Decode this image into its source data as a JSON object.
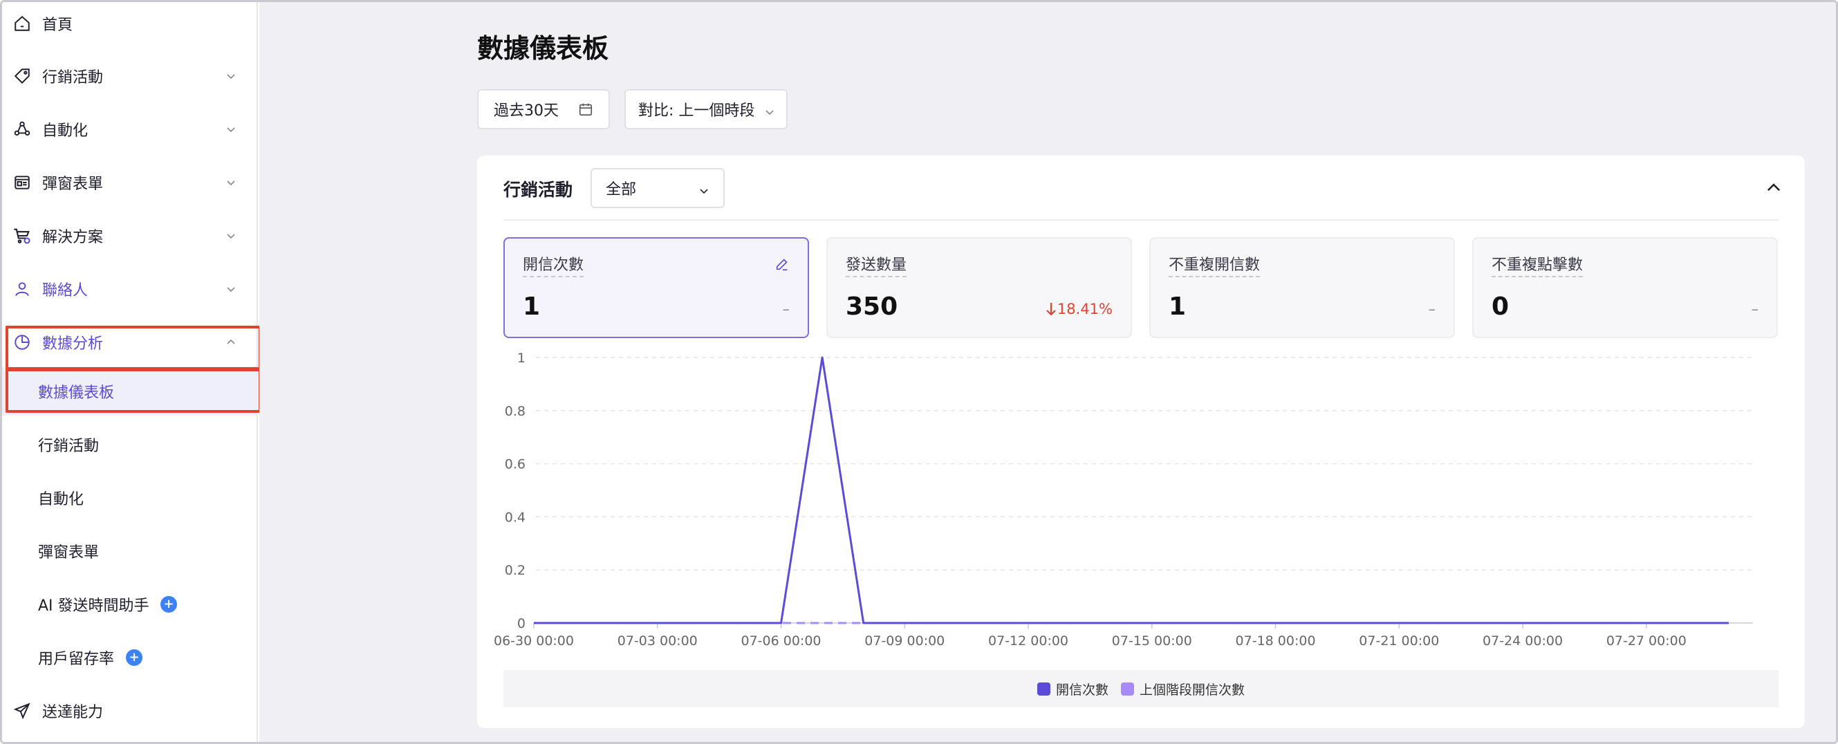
{
  "sidebar": {
    "items": [
      {
        "label": "首頁"
      },
      {
        "label": "行銷活動"
      },
      {
        "label": "自動化"
      },
      {
        "label": "彈窗表單"
      },
      {
        "label": "解決方案"
      },
      {
        "label": "聯絡人"
      },
      {
        "label": "數據分析"
      }
    ],
    "sub_items": [
      {
        "label": "數據儀表板"
      },
      {
        "label": "行銷活動"
      },
      {
        "label": "自動化"
      },
      {
        "label": "彈窗表單"
      },
      {
        "label": "AI 發送時間助手"
      },
      {
        "label": "用戶留存率"
      }
    ],
    "bottom_item": {
      "label": "送達能力"
    }
  },
  "page": {
    "title": "數據儀表板"
  },
  "filters": {
    "date_range": "過去30天",
    "compare": "對比: 上一個時段"
  },
  "card": {
    "title": "行銷活動",
    "select_value": "全部"
  },
  "metrics": [
    {
      "label": "開信次數",
      "value": "1",
      "change": "–"
    },
    {
      "label": "發送數量",
      "value": "350",
      "change": "18.41%"
    },
    {
      "label": "不重複開信數",
      "value": "1",
      "change": "–"
    },
    {
      "label": "不重複點擊數",
      "value": "0",
      "change": "–"
    }
  ],
  "colors": {
    "accent": "#5b4bdb",
    "prev_series": "#a78bfa",
    "down": "#e2432f",
    "annotation": "#e2432f"
  },
  "chart_data": {
    "type": "line",
    "x": [
      "06-30",
      "07-01",
      "07-02",
      "07-03",
      "07-04",
      "07-05",
      "07-06",
      "07-07",
      "07-08",
      "07-09",
      "07-10",
      "07-11",
      "07-12",
      "07-13",
      "07-14",
      "07-15",
      "07-16",
      "07-17",
      "07-18",
      "07-19",
      "07-20",
      "07-21",
      "07-22",
      "07-23",
      "07-24",
      "07-25",
      "07-26",
      "07-27",
      "07-28",
      "07-29"
    ],
    "xticks": [
      "06-30 00:00",
      "07-03 00:00",
      "07-06 00:00",
      "07-09 00:00",
      "07-12 00:00",
      "07-15 00:00",
      "07-18 00:00",
      "07-21 00:00",
      "07-24 00:00",
      "07-27 00:00"
    ],
    "yticks": [
      "0",
      "0.2",
      "0.4",
      "0.6",
      "0.8",
      "1"
    ],
    "ylim": [
      0,
      1
    ],
    "series": [
      {
        "name": "開信次數",
        "values": [
          0,
          0,
          0,
          0,
          0,
          0,
          0,
          1,
          0,
          0,
          0,
          0,
          0,
          0,
          0,
          0,
          0,
          0,
          0,
          0,
          0,
          0,
          0,
          0,
          0,
          0,
          0,
          0,
          0,
          0
        ]
      },
      {
        "name": "上個階段開信次數",
        "values": [
          0,
          0,
          0,
          0,
          0,
          0,
          0,
          0,
          0,
          0,
          0,
          0,
          0,
          0,
          0,
          0,
          0,
          0,
          0,
          0,
          0,
          0,
          0,
          0,
          0,
          0,
          0,
          0,
          0,
          0
        ]
      }
    ],
    "grid": true,
    "legend": "bottom-center"
  }
}
